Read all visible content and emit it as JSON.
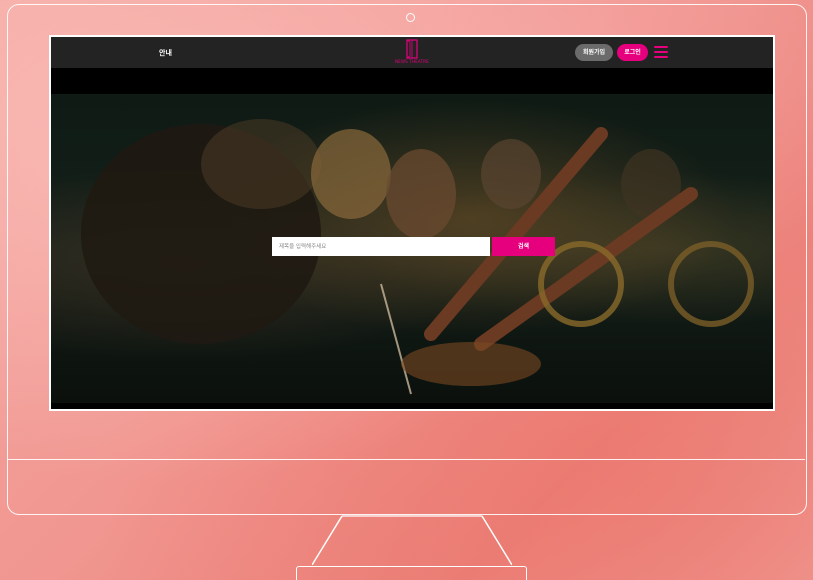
{
  "navbar": {
    "guide_label": "안내",
    "logo_text": "NEWS THEATRE",
    "signup_label": "회원가입",
    "login_label": "로그인"
  },
  "search": {
    "placeholder": "제목을 입력해주세요",
    "button_label": "검색"
  },
  "colors": {
    "accent": "#e6007e",
    "navbar_bg": "#232323",
    "signup_bg": "#6b6b6b"
  },
  "icons": [
    "camera-icon",
    "logo-icon",
    "menu-icon"
  ]
}
